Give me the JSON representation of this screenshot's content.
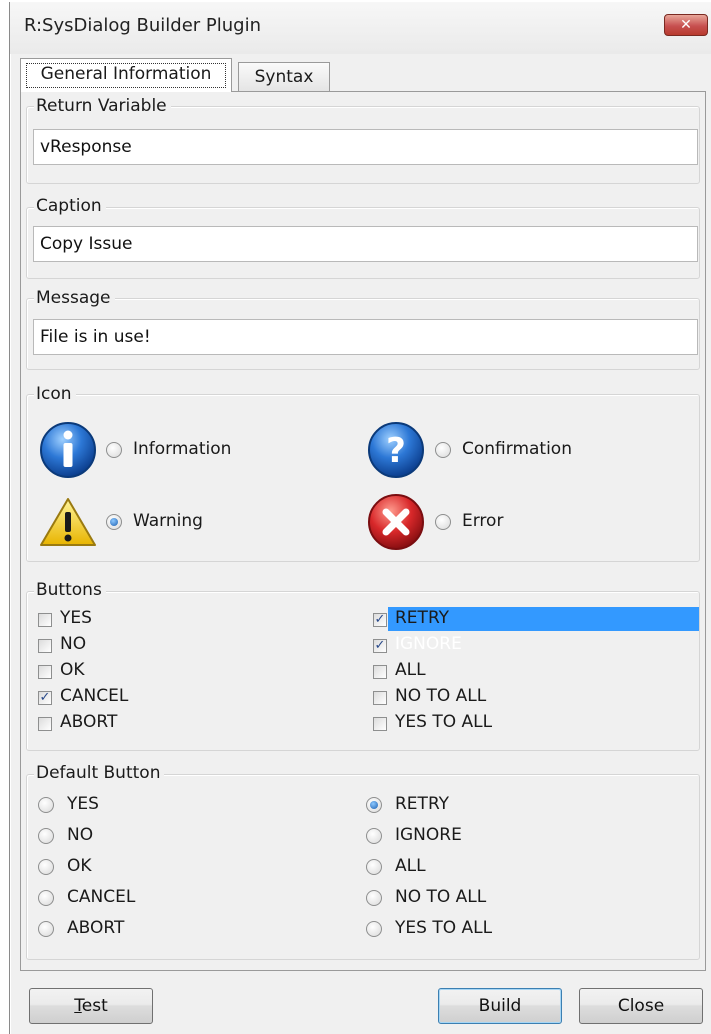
{
  "window": {
    "title": "R:SysDialog Builder Plugin",
    "close_glyph": "✕"
  },
  "tabs": [
    {
      "label": "General Information",
      "active": true
    },
    {
      "label": "Syntax",
      "active": false
    }
  ],
  "return_variable": {
    "label": "Return Variable",
    "value": "vResponse"
  },
  "caption": {
    "label": "Caption",
    "value": "Copy Issue"
  },
  "message": {
    "label": "Message",
    "value": "File is in use!"
  },
  "icon_group": {
    "label": "Icon",
    "options": [
      {
        "label": "Information",
        "icon": "information-icon",
        "selected": false
      },
      {
        "label": "Confirmation",
        "icon": "question-icon",
        "selected": false
      },
      {
        "label": "Warning",
        "icon": "warning-icon",
        "selected": true
      },
      {
        "label": "Error",
        "icon": "error-icon",
        "selected": false
      }
    ]
  },
  "buttons_group": {
    "label": "Buttons",
    "left": [
      {
        "label": "YES",
        "checked": false
      },
      {
        "label": "NO",
        "checked": false
      },
      {
        "label": "OK",
        "checked": false
      },
      {
        "label": "CANCEL",
        "checked": true
      },
      {
        "label": "ABORT",
        "checked": false
      }
    ],
    "right": [
      {
        "label": "RETRY",
        "checked": true
      },
      {
        "label": "IGNORE",
        "checked": true,
        "highlighted": true
      },
      {
        "label": "ALL",
        "checked": false
      },
      {
        "label": "NO TO ALL",
        "checked": false
      },
      {
        "label": "YES TO ALL",
        "checked": false
      }
    ]
  },
  "default_group": {
    "label": "Default Button",
    "left": [
      {
        "label": "YES",
        "selected": false
      },
      {
        "label": "NO",
        "selected": false
      },
      {
        "label": "OK",
        "selected": false
      },
      {
        "label": "CANCEL",
        "selected": false
      },
      {
        "label": "ABORT",
        "selected": false
      }
    ],
    "right": [
      {
        "label": "RETRY",
        "selected": true
      },
      {
        "label": "IGNORE",
        "selected": false
      },
      {
        "label": "ALL",
        "selected": false
      },
      {
        "label": "NO TO ALL",
        "selected": false
      },
      {
        "label": "YES TO ALL",
        "selected": false
      }
    ]
  },
  "footer": {
    "test_label": "Test",
    "test_underline": "T",
    "test_rest": "est",
    "build_label": "Build",
    "close_label": "Close"
  },
  "colors": {
    "selection": "#3399ff",
    "accent": "#1c5fb0"
  }
}
